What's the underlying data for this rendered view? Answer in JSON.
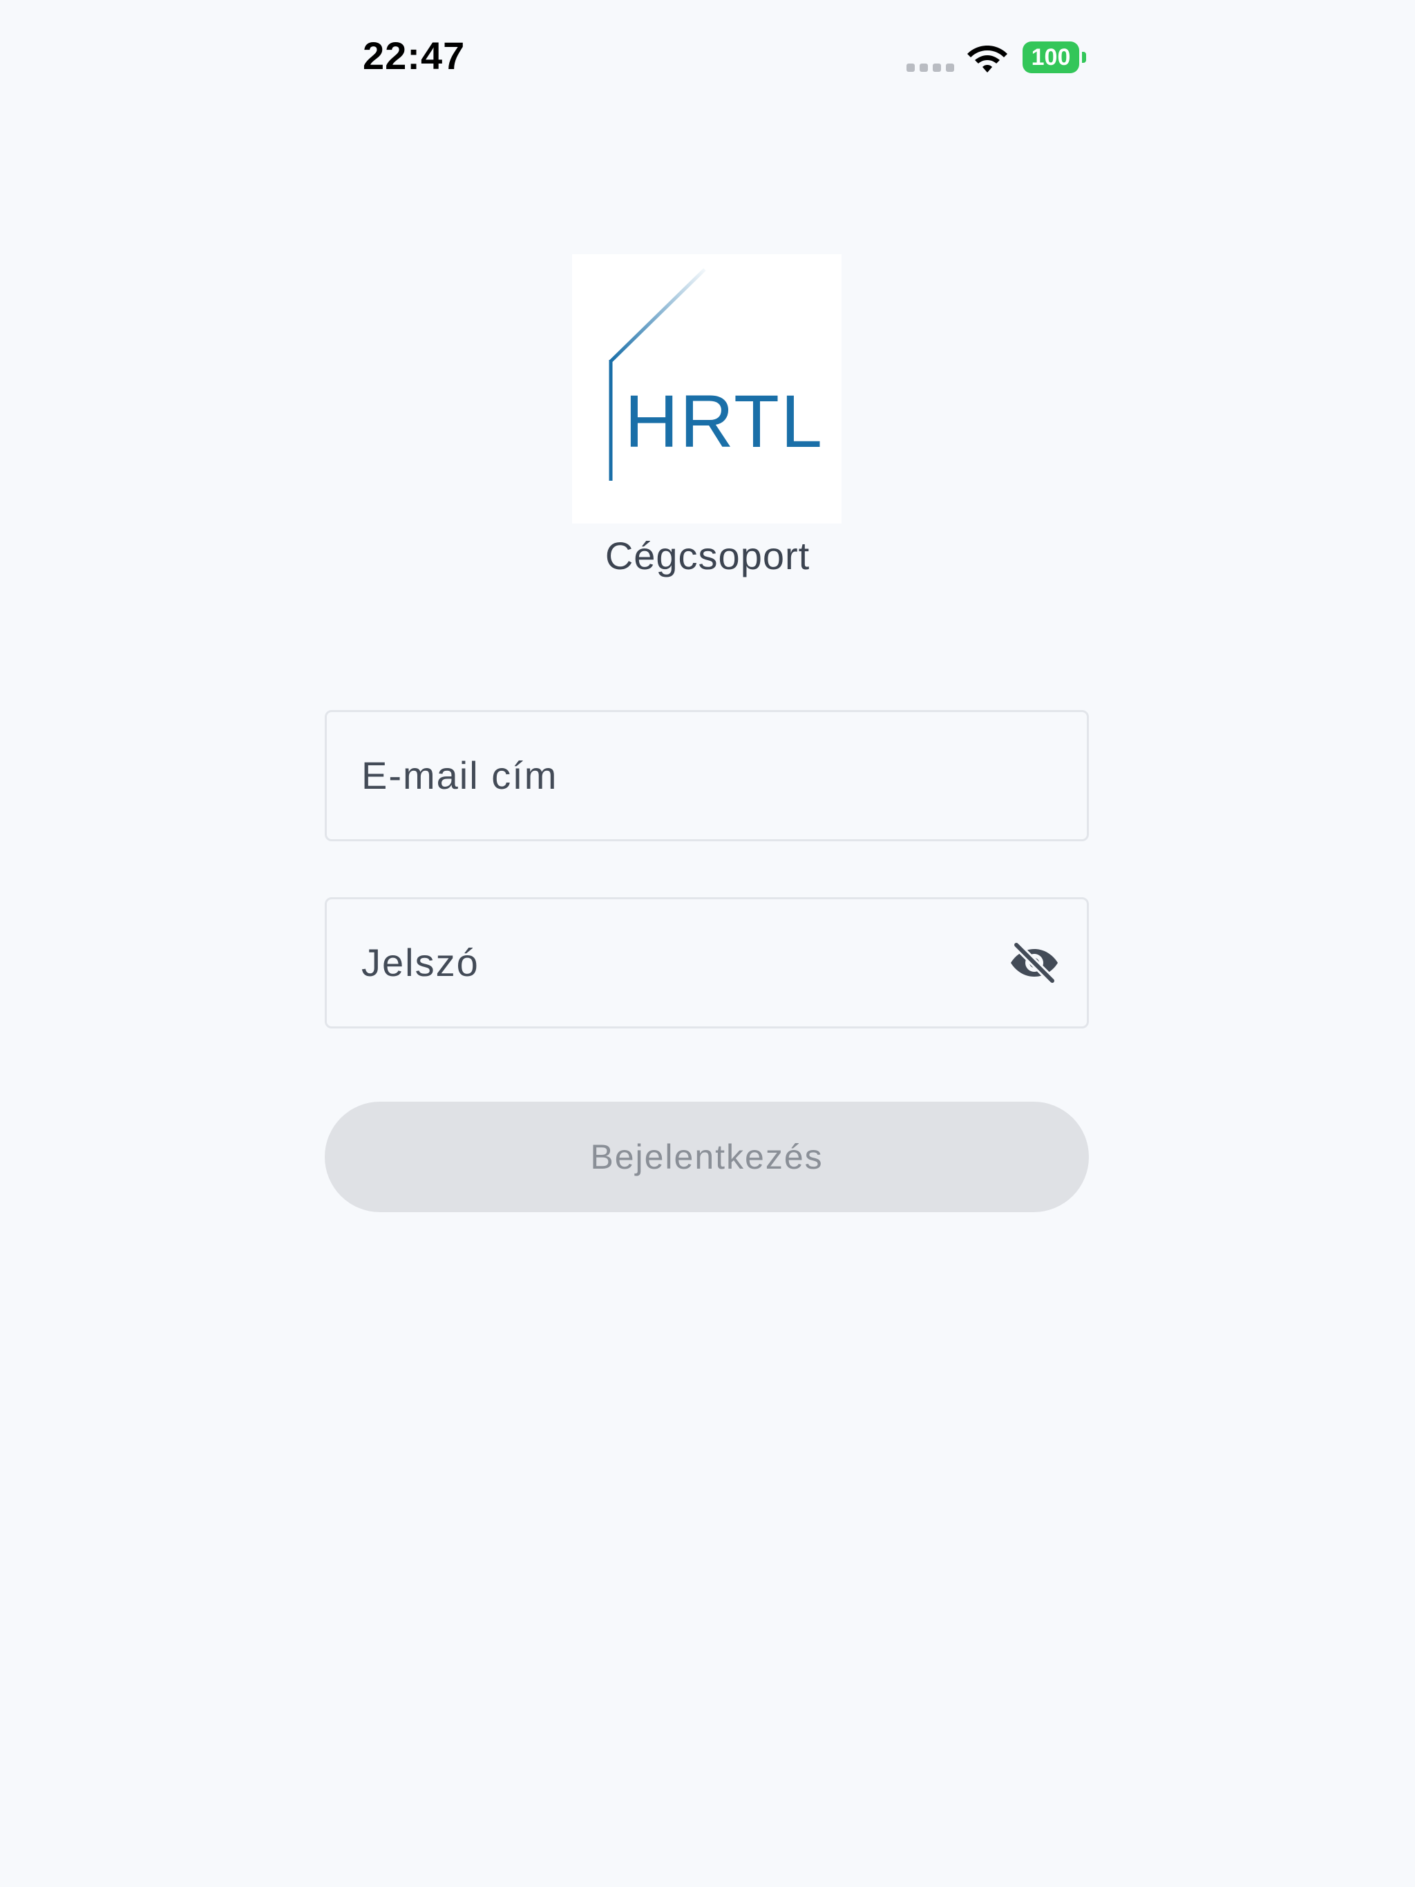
{
  "status_bar": {
    "time": "22:47",
    "battery": "100",
    "battery_color": "#33c659"
  },
  "logo": {
    "text": "HRTL",
    "color": "#1a6fa8"
  },
  "subtitle": "Cégcsoport",
  "form": {
    "email_placeholder": "E-mail cím",
    "password_placeholder": "Jelszó",
    "password_toggle_icon": "eye-off-icon",
    "login_label": "Bejelentkezés",
    "login_enabled": false
  },
  "colors": {
    "background": "#f7f9fc",
    "button_disabled_bg": "#dfe1e5",
    "button_disabled_text": "#8a8f97",
    "field_border": "#e2e5ea"
  }
}
